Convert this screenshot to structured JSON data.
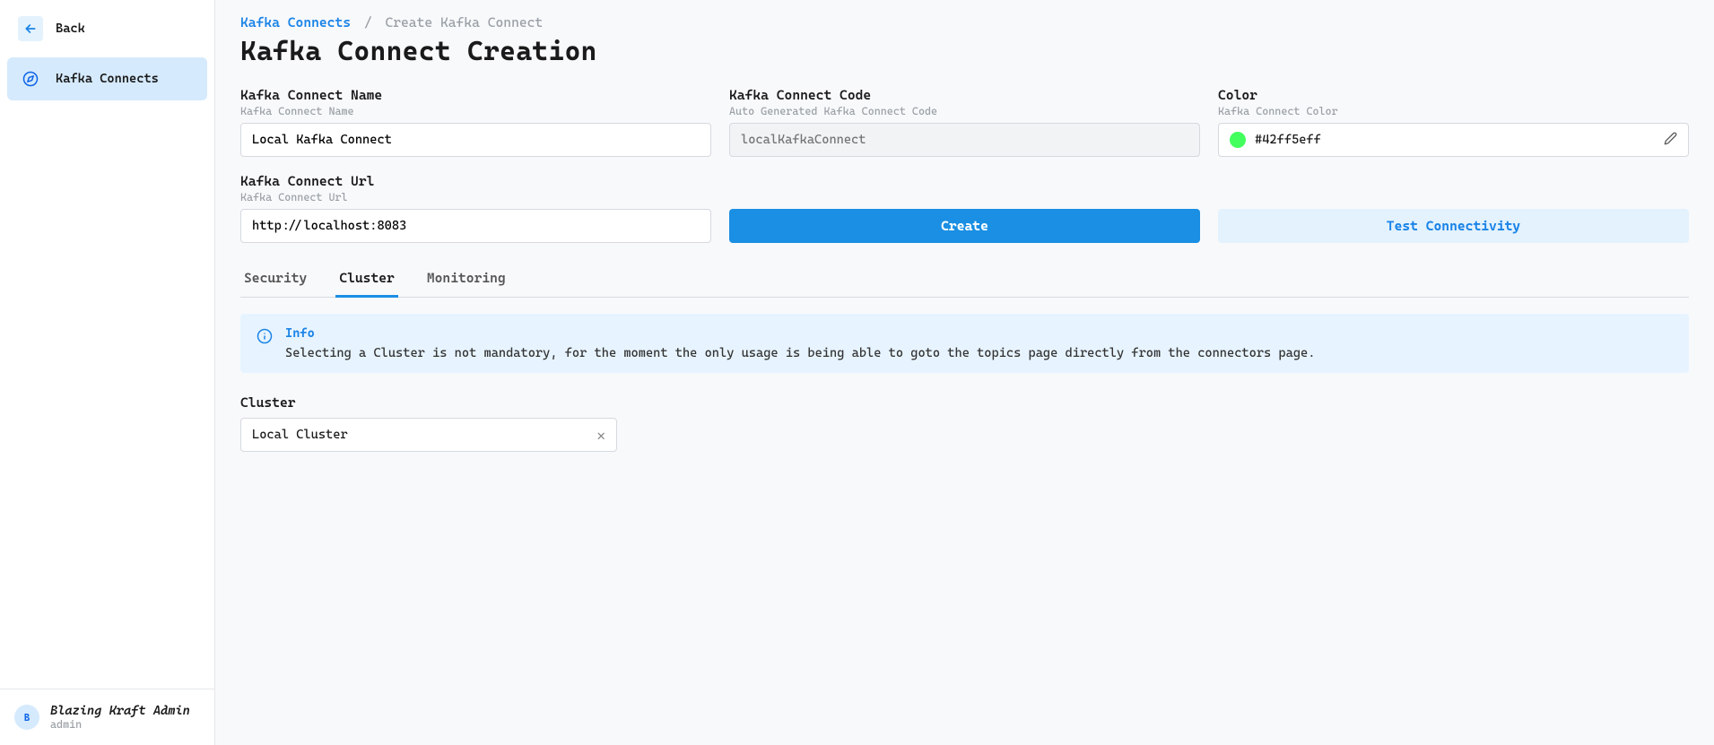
{
  "sidebar": {
    "back_label": "Back",
    "items": [
      {
        "label": "Kafka Connects"
      }
    ]
  },
  "user": {
    "avatar_initial": "B",
    "name": "Blazing Kraft Admin",
    "role": "admin"
  },
  "breadcrumb": {
    "link": "Kafka Connects",
    "current": "Create Kafka Connect"
  },
  "page_title": "Kafka Connect Creation",
  "fields": {
    "name": {
      "label": "Kafka Connect Name",
      "sub": "Kafka Connect Name",
      "value": "Local Kafka Connect"
    },
    "code": {
      "label": "Kafka Connect Code",
      "sub": "Auto Generated Kafka Connect Code",
      "placeholder": "localKafkaConnect"
    },
    "color": {
      "label": "Color",
      "sub": "Kafka Connect Color",
      "value": "#42ff5eff",
      "swatch": "#42ff5e"
    },
    "url": {
      "label": "Kafka Connect Url",
      "sub": "Kafka Connect Url",
      "value": "http://localhost:8083"
    }
  },
  "buttons": {
    "create": "Create",
    "test": "Test Connectivity"
  },
  "tabs": [
    {
      "label": "Security",
      "active": false
    },
    {
      "label": "Cluster",
      "active": true
    },
    {
      "label": "Monitoring",
      "active": false
    }
  ],
  "info": {
    "title": "Info",
    "body": "Selecting a Cluster is not mandatory, for the moment the only usage is being able to goto the topics page directly from the connectors page."
  },
  "cluster": {
    "label": "Cluster",
    "value": "Local Cluster"
  }
}
